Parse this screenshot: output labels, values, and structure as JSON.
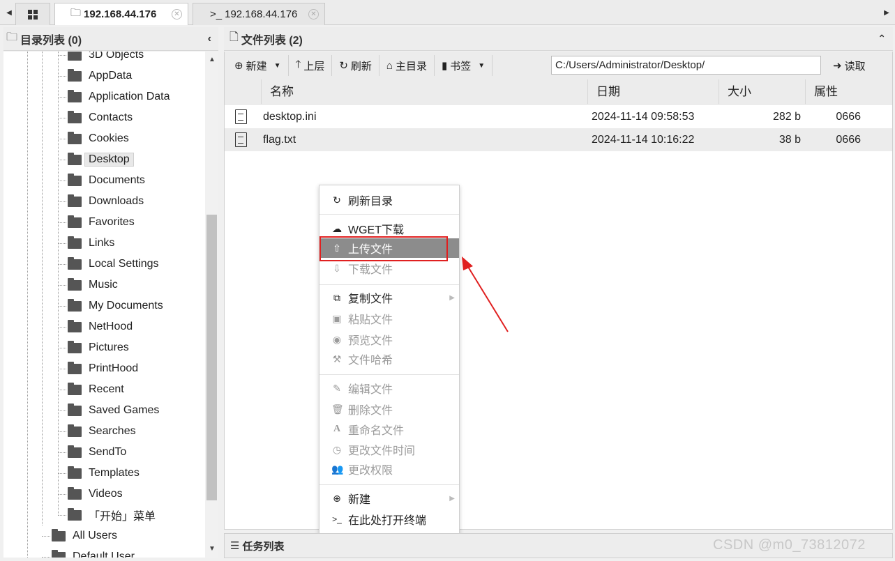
{
  "tabs": [
    {
      "label": "192.168.44.176",
      "icon": "database-icon",
      "active": true
    },
    {
      "label": "192.168.44.176",
      "icon": "terminal-icon",
      "prefix": ">_",
      "active": false
    }
  ],
  "left_panel": {
    "title": "目录列表 (0)",
    "items": [
      "3D Objects",
      "AppData",
      "Application Data",
      "Contacts",
      "Cookies",
      "Desktop",
      "Documents",
      "Downloads",
      "Favorites",
      "Links",
      "Local Settings",
      "Music",
      "My Documents",
      "NetHood",
      "Pictures",
      "PrintHood",
      "Recent",
      "Saved Games",
      "Searches",
      "SendTo",
      "Templates",
      "Videos",
      "「开始」菜单"
    ],
    "selected": "Desktop",
    "parent_items": [
      "All Users",
      "Default User"
    ]
  },
  "right_panel": {
    "title": "文件列表 (2)",
    "toolbar": {
      "new_label": "新建",
      "up_label": "上层",
      "refresh_label": "刷新",
      "home_label": "主目录",
      "bookmark_label": "书签",
      "path_value": "C:/Users/Administrator/Desktop/",
      "read_label": "读取"
    },
    "columns": [
      "名称",
      "日期",
      "大小",
      "属性"
    ],
    "files": [
      {
        "name": "desktop.ini",
        "date": "2024-11-14 09:58:53",
        "size": "282 b",
        "attr": "0666"
      },
      {
        "name": "flag.txt",
        "date": "2024-11-14 10:16:22",
        "size": "38 b",
        "attr": "0666"
      }
    ]
  },
  "context_menu": {
    "refresh_dir": "刷新目录",
    "wget": "WGET下载",
    "upload": "上传文件",
    "download": "下载文件",
    "copy": "复制文件",
    "paste": "粘贴文件",
    "preview": "预览文件",
    "hash": "文件哈希",
    "edit": "编辑文件",
    "delete": "删除文件",
    "rename": "重命名文件",
    "change_time": "更改文件时间",
    "change_perm": "更改权限",
    "new": "新建",
    "open_terminal": "在此处打开终端",
    "highlighted": "上传文件"
  },
  "task_panel": {
    "title": "任务列表"
  },
  "watermark": "CSDN @m0_73812072",
  "colors": {
    "highlight": "#8c8c8c",
    "annotation_red": "#e02020"
  }
}
